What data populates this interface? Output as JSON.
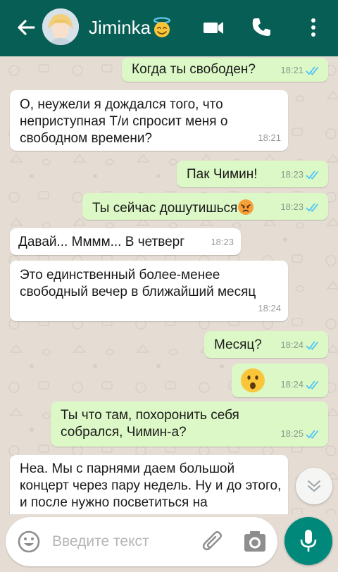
{
  "header": {
    "contact_name": "Jiminka",
    "background": "#075e54"
  },
  "messages": [
    {
      "side": "out",
      "text": "Когда ты свободен?",
      "time": "18:21",
      "read": true
    },
    {
      "side": "in",
      "text": "О, неужели я дождался того, что неприступная Т/и спросит меня о свободном времени?",
      "time": "18:21"
    },
    {
      "side": "out",
      "text": "Пак Чимин!",
      "time": "18:23",
      "read": true
    },
    {
      "side": "out",
      "text": "Ты сейчас дошутишься",
      "time": "18:23",
      "read": true,
      "emoji": "angry"
    },
    {
      "side": "in",
      "text": "Давай... Мммм... В четверг",
      "time": "18:23"
    },
    {
      "side": "in",
      "text": "Это единственный более-менее свободный вечер в ближайший месяц",
      "time": "18:24"
    },
    {
      "side": "out",
      "text": "Месяц?",
      "time": "18:24",
      "read": true
    },
    {
      "side": "out",
      "text": "",
      "time": "18:24",
      "read": true,
      "emoji": "surprised"
    },
    {
      "side": "out",
      "text": "Ты что там, похоронить себя собрался, Чимин-а?",
      "time": "18:25",
      "read": true
    },
    {
      "side": "in",
      "text": "Неа. Мы с парнями даем большой концерт через пару недель. Ну и до этого, и после нужно посветиться на",
      "time": ""
    }
  ],
  "input": {
    "placeholder": "Введите текст"
  },
  "colors": {
    "outgoing_bubble": "#dcf8c6",
    "incoming_bubble": "#ffffff",
    "read_ticks": "#4fc3f7",
    "mic_button": "#00897b"
  }
}
